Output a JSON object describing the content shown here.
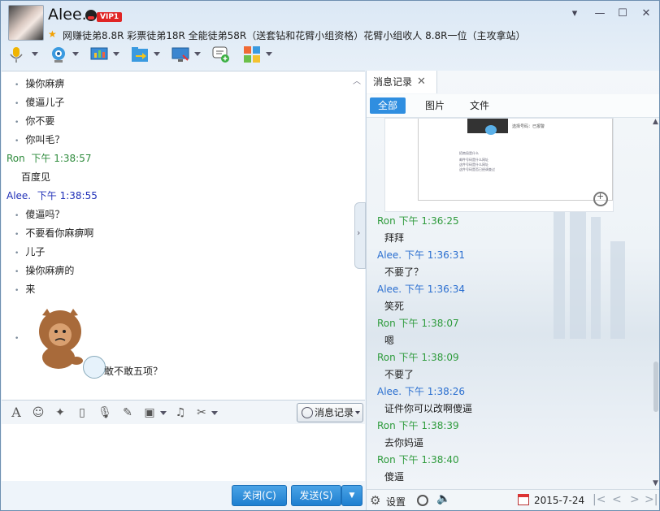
{
  "window": {
    "nickname": "Alee.",
    "vip_label": "VIP1",
    "signature": "网赚徒弟8.8R 彩票徒弟18R 全能徒弟58R（送套钻和花臂小组资格）花臂小组收人 8.8R一位（主攻拿站）",
    "controls": {
      "minimize": "▾",
      "restore": "—",
      "maximize": "☐",
      "close": "✕"
    }
  },
  "chat": {
    "messages": [
      {
        "type": "bullet",
        "text": "操你麻痹"
      },
      {
        "type": "bullet",
        "text": "傻逼儿子"
      },
      {
        "type": "bullet",
        "text": "你不要"
      },
      {
        "type": "bullet",
        "text": "你叫毛？"
      },
      {
        "type": "header",
        "sender": "Ron",
        "time": "下午 1:38:57",
        "color": "#2e8b3c"
      },
      {
        "type": "plain",
        "text": "百度见"
      },
      {
        "type": "header",
        "sender": "Alee.",
        "time": "下午 1:38:55",
        "color": "#2030b8"
      },
      {
        "type": "bullet",
        "text": "傻逼吗？"
      },
      {
        "type": "bullet",
        "text": "不要看你麻痹啊"
      },
      {
        "type": "bullet",
        "text": "儿子"
      },
      {
        "type": "bullet",
        "text": "操你麻痹的"
      },
      {
        "type": "bullet",
        "text": "来"
      }
    ],
    "sticker_caption": "敢不敢五项？"
  },
  "input_toolbar": {
    "msg_record_label": "消息记录"
  },
  "send_bar": {
    "close_label": "关闭(C)",
    "send_label": "发送(S)"
  },
  "history": {
    "tab_label": "消息记录",
    "filters": [
      "全部",
      "图片",
      "文件"
    ],
    "screenshot_title": "选择号码：已报警",
    "screenshot_lines": [
      "招商局是什么",
      "邮件号码是什么网址",
      "这件号码是什么网址",
      "这件号码是否已经调查过"
    ],
    "messages": [
      {
        "sender": "Ron",
        "time": "下午 1:36:25",
        "text": "拜拜"
      },
      {
        "sender": "Alee.",
        "time": "下午 1:36:31",
        "text": "不要了？"
      },
      {
        "sender": "Alee.",
        "time": "下午 1:36:34",
        "text": "笑死"
      },
      {
        "sender": "Ron",
        "time": "下午 1:38:07",
        "text": "嗯"
      },
      {
        "sender": "Ron",
        "time": "下午 1:38:09",
        "text": "不要了"
      },
      {
        "sender": "Alee.",
        "time": "下午 1:38:26",
        "text": "证件你可以改啊傻逼"
      },
      {
        "sender": "Ron",
        "time": "下午 1:38:39",
        "text": "去你妈逼"
      },
      {
        "sender": "Ron",
        "time": "下午 1:38:40",
        "text": "傻逼"
      }
    ],
    "settings_label": "设置",
    "date": "2015-7-24"
  }
}
